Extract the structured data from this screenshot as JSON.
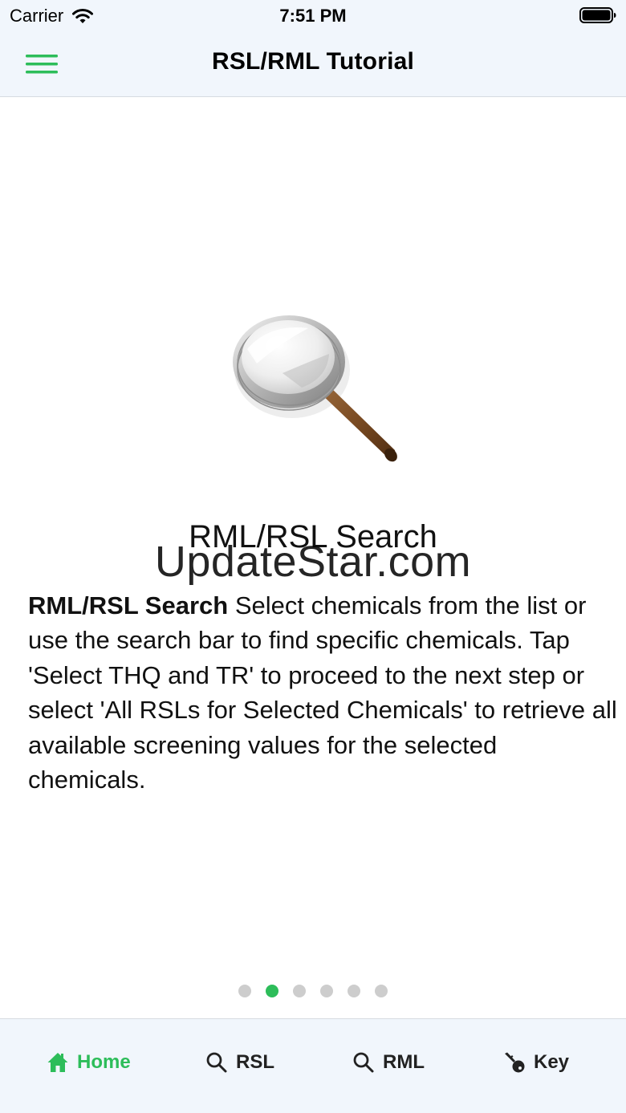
{
  "status_bar": {
    "carrier": "Carrier",
    "time": "7:51 PM"
  },
  "nav": {
    "title": "RSL/RML Tutorial",
    "menu_icon": "hamburger-menu-icon"
  },
  "slide": {
    "title": "RML/RSL Search",
    "body_bold": "RML/RSL Search",
    "body_text": " Select chemicals from the list or use the search bar to find specific chemicals. Tap 'Select THQ and TR' to proceed to the next step or select 'All RSLs for Selected Chemicals' to retrieve all available screening values for the selected chemicals.",
    "image_icon": "magnifying-glass-icon"
  },
  "watermark": "UpdateStar.com",
  "pagination": {
    "count": 6,
    "active_index": 1
  },
  "tabs": [
    {
      "label": "Home",
      "icon": "home-icon",
      "active": true
    },
    {
      "label": "RSL",
      "icon": "search-icon",
      "active": false
    },
    {
      "label": "RML",
      "icon": "search-icon",
      "active": false
    },
    {
      "label": "Key",
      "icon": "key-icon",
      "active": false
    }
  ],
  "colors": {
    "accent": "#2dbd5a",
    "bar_background": "#f1f6fc",
    "dot_inactive": "#cdcdcd"
  }
}
